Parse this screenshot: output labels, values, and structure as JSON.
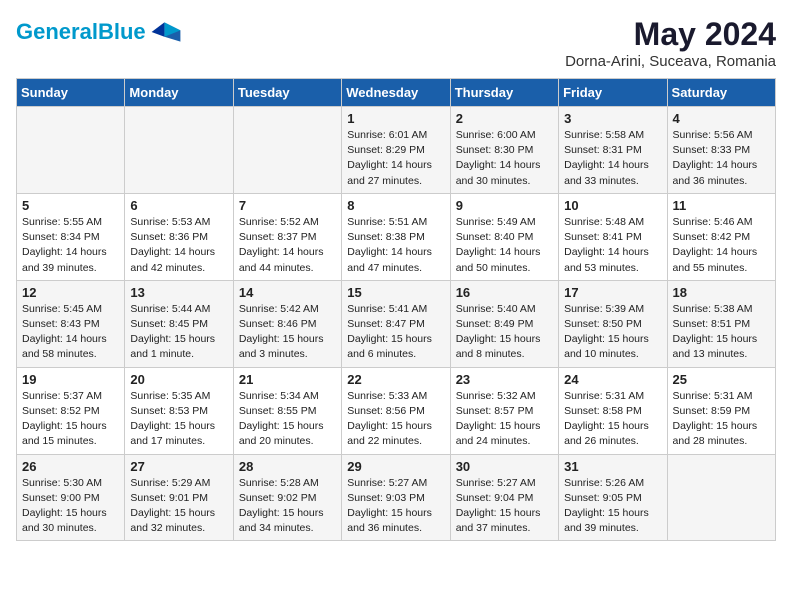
{
  "logo": {
    "general": "General",
    "blue": "Blue"
  },
  "title": "May 2024",
  "subtitle": "Dorna-Arini, Suceava, Romania",
  "headers": [
    "Sunday",
    "Monday",
    "Tuesday",
    "Wednesday",
    "Thursday",
    "Friday",
    "Saturday"
  ],
  "weeks": [
    [
      {
        "day": "",
        "info": ""
      },
      {
        "day": "",
        "info": ""
      },
      {
        "day": "",
        "info": ""
      },
      {
        "day": "1",
        "info": "Sunrise: 6:01 AM\nSunset: 8:29 PM\nDaylight: 14 hours\nand 27 minutes."
      },
      {
        "day": "2",
        "info": "Sunrise: 6:00 AM\nSunset: 8:30 PM\nDaylight: 14 hours\nand 30 minutes."
      },
      {
        "day": "3",
        "info": "Sunrise: 5:58 AM\nSunset: 8:31 PM\nDaylight: 14 hours\nand 33 minutes."
      },
      {
        "day": "4",
        "info": "Sunrise: 5:56 AM\nSunset: 8:33 PM\nDaylight: 14 hours\nand 36 minutes."
      }
    ],
    [
      {
        "day": "5",
        "info": "Sunrise: 5:55 AM\nSunset: 8:34 PM\nDaylight: 14 hours\nand 39 minutes."
      },
      {
        "day": "6",
        "info": "Sunrise: 5:53 AM\nSunset: 8:36 PM\nDaylight: 14 hours\nand 42 minutes."
      },
      {
        "day": "7",
        "info": "Sunrise: 5:52 AM\nSunset: 8:37 PM\nDaylight: 14 hours\nand 44 minutes."
      },
      {
        "day": "8",
        "info": "Sunrise: 5:51 AM\nSunset: 8:38 PM\nDaylight: 14 hours\nand 47 minutes."
      },
      {
        "day": "9",
        "info": "Sunrise: 5:49 AM\nSunset: 8:40 PM\nDaylight: 14 hours\nand 50 minutes."
      },
      {
        "day": "10",
        "info": "Sunrise: 5:48 AM\nSunset: 8:41 PM\nDaylight: 14 hours\nand 53 minutes."
      },
      {
        "day": "11",
        "info": "Sunrise: 5:46 AM\nSunset: 8:42 PM\nDaylight: 14 hours\nand 55 minutes."
      }
    ],
    [
      {
        "day": "12",
        "info": "Sunrise: 5:45 AM\nSunset: 8:43 PM\nDaylight: 14 hours\nand 58 minutes."
      },
      {
        "day": "13",
        "info": "Sunrise: 5:44 AM\nSunset: 8:45 PM\nDaylight: 15 hours\nand 1 minute."
      },
      {
        "day": "14",
        "info": "Sunrise: 5:42 AM\nSunset: 8:46 PM\nDaylight: 15 hours\nand 3 minutes."
      },
      {
        "day": "15",
        "info": "Sunrise: 5:41 AM\nSunset: 8:47 PM\nDaylight: 15 hours\nand 6 minutes."
      },
      {
        "day": "16",
        "info": "Sunrise: 5:40 AM\nSunset: 8:49 PM\nDaylight: 15 hours\nand 8 minutes."
      },
      {
        "day": "17",
        "info": "Sunrise: 5:39 AM\nSunset: 8:50 PM\nDaylight: 15 hours\nand 10 minutes."
      },
      {
        "day": "18",
        "info": "Sunrise: 5:38 AM\nSunset: 8:51 PM\nDaylight: 15 hours\nand 13 minutes."
      }
    ],
    [
      {
        "day": "19",
        "info": "Sunrise: 5:37 AM\nSunset: 8:52 PM\nDaylight: 15 hours\nand 15 minutes."
      },
      {
        "day": "20",
        "info": "Sunrise: 5:35 AM\nSunset: 8:53 PM\nDaylight: 15 hours\nand 17 minutes."
      },
      {
        "day": "21",
        "info": "Sunrise: 5:34 AM\nSunset: 8:55 PM\nDaylight: 15 hours\nand 20 minutes."
      },
      {
        "day": "22",
        "info": "Sunrise: 5:33 AM\nSunset: 8:56 PM\nDaylight: 15 hours\nand 22 minutes."
      },
      {
        "day": "23",
        "info": "Sunrise: 5:32 AM\nSunset: 8:57 PM\nDaylight: 15 hours\nand 24 minutes."
      },
      {
        "day": "24",
        "info": "Sunrise: 5:31 AM\nSunset: 8:58 PM\nDaylight: 15 hours\nand 26 minutes."
      },
      {
        "day": "25",
        "info": "Sunrise: 5:31 AM\nSunset: 8:59 PM\nDaylight: 15 hours\nand 28 minutes."
      }
    ],
    [
      {
        "day": "26",
        "info": "Sunrise: 5:30 AM\nSunset: 9:00 PM\nDaylight: 15 hours\nand 30 minutes."
      },
      {
        "day": "27",
        "info": "Sunrise: 5:29 AM\nSunset: 9:01 PM\nDaylight: 15 hours\nand 32 minutes."
      },
      {
        "day": "28",
        "info": "Sunrise: 5:28 AM\nSunset: 9:02 PM\nDaylight: 15 hours\nand 34 minutes."
      },
      {
        "day": "29",
        "info": "Sunrise: 5:27 AM\nSunset: 9:03 PM\nDaylight: 15 hours\nand 36 minutes."
      },
      {
        "day": "30",
        "info": "Sunrise: 5:27 AM\nSunset: 9:04 PM\nDaylight: 15 hours\nand 37 minutes."
      },
      {
        "day": "31",
        "info": "Sunrise: 5:26 AM\nSunset: 9:05 PM\nDaylight: 15 hours\nand 39 minutes."
      },
      {
        "day": "",
        "info": ""
      }
    ]
  ]
}
